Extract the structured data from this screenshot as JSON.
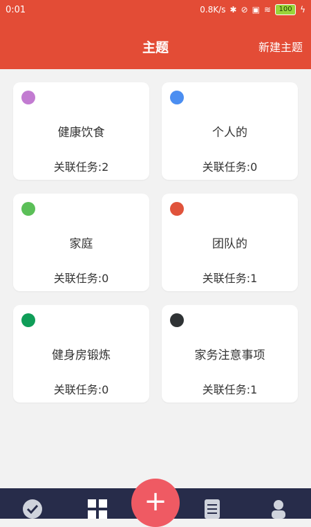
{
  "status": {
    "time": "0:01",
    "network": "0.8K/s",
    "battery": "100"
  },
  "header": {
    "title": "主题",
    "new_topic": "新建主题"
  },
  "colors": {
    "appbar": "#e34c36",
    "fab": "#ef5a63",
    "bottombar": "#272c4a"
  },
  "topics": [
    {
      "name": "健康饮食",
      "count_text": "关联任务:2",
      "color": "#c27bd1"
    },
    {
      "name": "个人的",
      "count_text": "关联任务:0",
      "color": "#4b8ef1"
    },
    {
      "name": "家庭",
      "count_text": "关联任务:0",
      "color": "#5bbf58"
    },
    {
      "name": "团队的",
      "count_text": "关联任务:1",
      "color": "#e0533b"
    },
    {
      "name": "健身房锻炼",
      "count_text": "关联任务:0",
      "color": "#0f9d58"
    },
    {
      "name": "家务注意事项",
      "count_text": "关联任务:1",
      "color": "#2f3335"
    }
  ],
  "fab": {
    "label": "+"
  },
  "bottom_nav": {
    "items": [
      {
        "icon": "check-circle-icon"
      },
      {
        "icon": "grid-icon"
      },
      {
        "icon": "checklist-icon"
      },
      {
        "icon": "person-icon"
      }
    ]
  }
}
